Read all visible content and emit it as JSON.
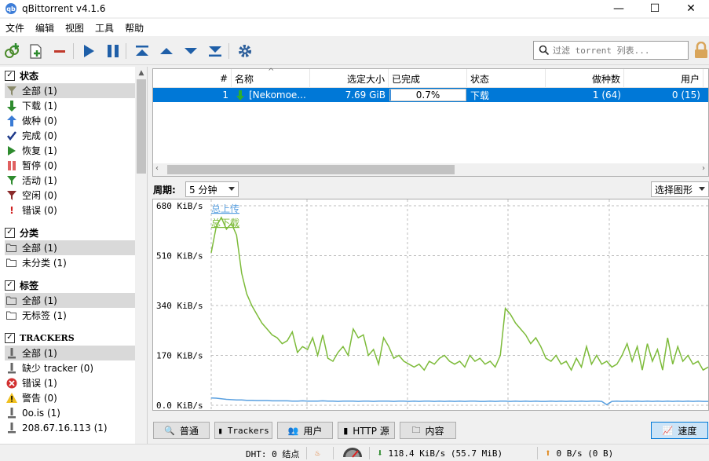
{
  "window": {
    "title": "qBittorrent v4.1.6",
    "app_icon": "qb",
    "minimize": "—",
    "maximize": "☐",
    "close": "✕"
  },
  "menu": [
    "文件",
    "编辑",
    "视图",
    "工具",
    "帮助"
  ],
  "search": {
    "placeholder": "过滤 torrent 列表..."
  },
  "sidebar": {
    "status": {
      "header": "状态",
      "items": [
        {
          "label": "全部 (1)",
          "icon": "filter-icon"
        },
        {
          "label": "下载 (1)",
          "icon": "download-arrow-icon"
        },
        {
          "label": "做种 (0)",
          "icon": "upload-arrow-icon"
        },
        {
          "label": "完成 (0)",
          "icon": "checkmark-icon"
        },
        {
          "label": "恢复 (1)",
          "icon": "play-icon"
        },
        {
          "label": "暂停 (0)",
          "icon": "pause-icon"
        },
        {
          "label": "活动 (1)",
          "icon": "active-filter-icon"
        },
        {
          "label": "空闲 (0)",
          "icon": "inactive-filter-icon"
        },
        {
          "label": "错误 (0)",
          "icon": "exclamation-icon"
        }
      ]
    },
    "categories": {
      "header": "分类",
      "items": [
        {
          "label": "全部 (1)"
        },
        {
          "label": "未分类 (1)"
        }
      ]
    },
    "tags": {
      "header": "标签",
      "items": [
        {
          "label": "全部 (1)"
        },
        {
          "label": "无标签 (1)"
        }
      ]
    },
    "trackers": {
      "header": "TRACKERS",
      "items": [
        {
          "label": "全部 (1)",
          "icon": "tracker-icon"
        },
        {
          "label": "缺少 tracker (0)",
          "icon": "tracker-icon"
        },
        {
          "label": "错误 (1)",
          "icon": "error-icon"
        },
        {
          "label": "警告 (0)",
          "icon": "warning-icon"
        },
        {
          "label": "0o.is (1)",
          "icon": "tracker-icon"
        },
        {
          "label": "208.67.16.113 (1)",
          "icon": "tracker-icon"
        }
      ]
    }
  },
  "table": {
    "columns": {
      "num": "#",
      "name": "名称",
      "size": "选定大小",
      "done": "已完成",
      "status": "状态",
      "seeds": "做种数",
      "peers": "用户"
    },
    "rows": [
      {
        "num": "1",
        "name": "[Nekomoe...",
        "size": "7.69 GiB",
        "done": "0.7%",
        "progress": 0.007,
        "status": "下载",
        "seeds": "1 (64)",
        "peers": "0 (15)"
      }
    ]
  },
  "graph": {
    "period_label": "周期:",
    "period_value": "5 分钟",
    "select_label": "选择图形",
    "legend": {
      "upload": "总上传",
      "download": "总下载"
    },
    "colors": {
      "upload": "#5aa0e0",
      "download": "#7dbb3a"
    }
  },
  "chart_data": {
    "type": "line",
    "y_ticks": [
      "680  KiB/s",
      "510  KiB/s",
      "340  KiB/s",
      "170  KiB/s",
      "0.0  KiB/s"
    ],
    "ylim": [
      0,
      680
    ],
    "unit": "KiB/s",
    "series": [
      {
        "name": "总下载",
        "values": [
          520,
          610,
          640,
          600,
          620,
          580,
          450,
          380,
          340,
          310,
          280,
          260,
          240,
          230,
          210,
          220,
          250,
          180,
          200,
          190,
          230,
          170,
          240,
          160,
          150,
          180,
          200,
          170,
          260,
          230,
          240,
          170,
          190,
          140,
          230,
          200,
          160,
          170,
          150,
          140,
          130,
          140,
          120,
          150,
          140,
          160,
          170,
          150,
          140,
          150,
          130,
          170,
          150,
          160,
          140,
          150,
          130,
          170,
          330,
          310,
          280,
          260,
          240,
          210,
          230,
          200,
          160,
          150,
          170,
          140,
          150,
          120,
          160,
          130,
          200,
          140,
          170,
          140,
          150,
          130,
          140,
          170,
          210,
          150,
          200,
          120,
          210,
          150,
          190,
          120,
          230,
          140,
          200,
          150,
          170,
          140,
          150,
          120,
          130
        ]
      },
      {
        "name": "总上传",
        "values": [
          25,
          24,
          22,
          20,
          19,
          18,
          18,
          17,
          17,
          16,
          16,
          16,
          15,
          15,
          15,
          15,
          14,
          14,
          15,
          14,
          14,
          14,
          15,
          14,
          14,
          13,
          14,
          14,
          14,
          13,
          14,
          14,
          13,
          14,
          14,
          14,
          13,
          14,
          14,
          13,
          14,
          13,
          14,
          14,
          13,
          14,
          13,
          14,
          13,
          14,
          13,
          14,
          14,
          13,
          13,
          14,
          13,
          14,
          14,
          13,
          14,
          13,
          14,
          13,
          14,
          13,
          13,
          14,
          13,
          14,
          13,
          14,
          13,
          14,
          13,
          14,
          14,
          13,
          2,
          13,
          14,
          13,
          14,
          13,
          14,
          13,
          14,
          13,
          14,
          13,
          14,
          13,
          14,
          13,
          14,
          13,
          14,
          13,
          13
        ]
      }
    ]
  },
  "tabs": [
    "普通",
    "Trackers",
    "用户",
    "HTTP 源",
    "内容",
    "速度"
  ],
  "statusbar": {
    "dht": "DHT: 0 结点",
    "down": "118.4  KiB/s (55.7  MiB)",
    "up": "0  B/s (0  B)"
  }
}
